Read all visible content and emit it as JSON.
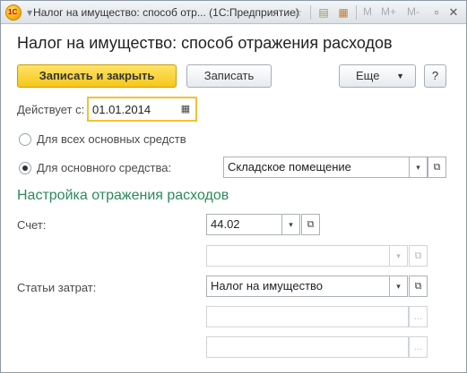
{
  "window": {
    "title": "Налог на имущество: способ отр...  (1С:Предприятие)",
    "app_logo_text": "1С",
    "toolbar_m_labels": [
      "M",
      "M+",
      "M-"
    ]
  },
  "form": {
    "title": "Налог на имущество: способ отражения расходов"
  },
  "actions": {
    "save_close_label": "Записать и закрыть",
    "save_label": "Записать",
    "more_label": "Еще",
    "help_label": "?"
  },
  "effective": {
    "label": "Действует с:",
    "date_value": "01.01.2014"
  },
  "scope": {
    "all_assets_label": "Для всех основных средств",
    "one_asset_label": "Для основного средства:",
    "selected": "one_asset",
    "asset_value": "Складское помещение"
  },
  "settings": {
    "section_title": "Настройка отражения расходов",
    "account_label": "Счет:",
    "account_value": "44.02",
    "subconto_value": "",
    "cost_items_label": "Статьи затрат:",
    "cost_item_value": "Налог на имущество",
    "extra1_value": "",
    "extra2_value": ""
  },
  "icons": {
    "dropdown": "▾",
    "open": "⧉",
    "calendar": "▦",
    "ellipsis": "..."
  }
}
